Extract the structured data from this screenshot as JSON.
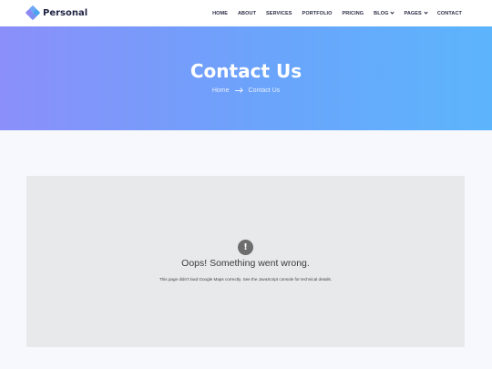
{
  "header": {
    "logo_text": "Personal",
    "nav": [
      {
        "label": "HOME",
        "dropdown": false
      },
      {
        "label": "ABOUT",
        "dropdown": false
      },
      {
        "label": "SERVICES",
        "dropdown": false
      },
      {
        "label": "PORTFOLIO",
        "dropdown": false
      },
      {
        "label": "PRICING",
        "dropdown": false
      },
      {
        "label": "BLOG",
        "dropdown": true
      },
      {
        "label": "PAGES",
        "dropdown": true
      },
      {
        "label": "CONTACT",
        "dropdown": false
      }
    ]
  },
  "hero": {
    "title": "Contact Us",
    "breadcrumb": {
      "home": "Home",
      "current": "Contact Us"
    }
  },
  "map": {
    "error_icon": "!",
    "error_title": "Oops! Something went wrong.",
    "error_message": "This page didn't load Google Maps correctly. See the JavaScript console for technical details."
  },
  "colors": {
    "hero_gradient_start": "#8b8ffa",
    "hero_gradient_end": "#5cb5fc",
    "header_bg": "#ffffff",
    "map_bg": "#e8e9eb"
  }
}
